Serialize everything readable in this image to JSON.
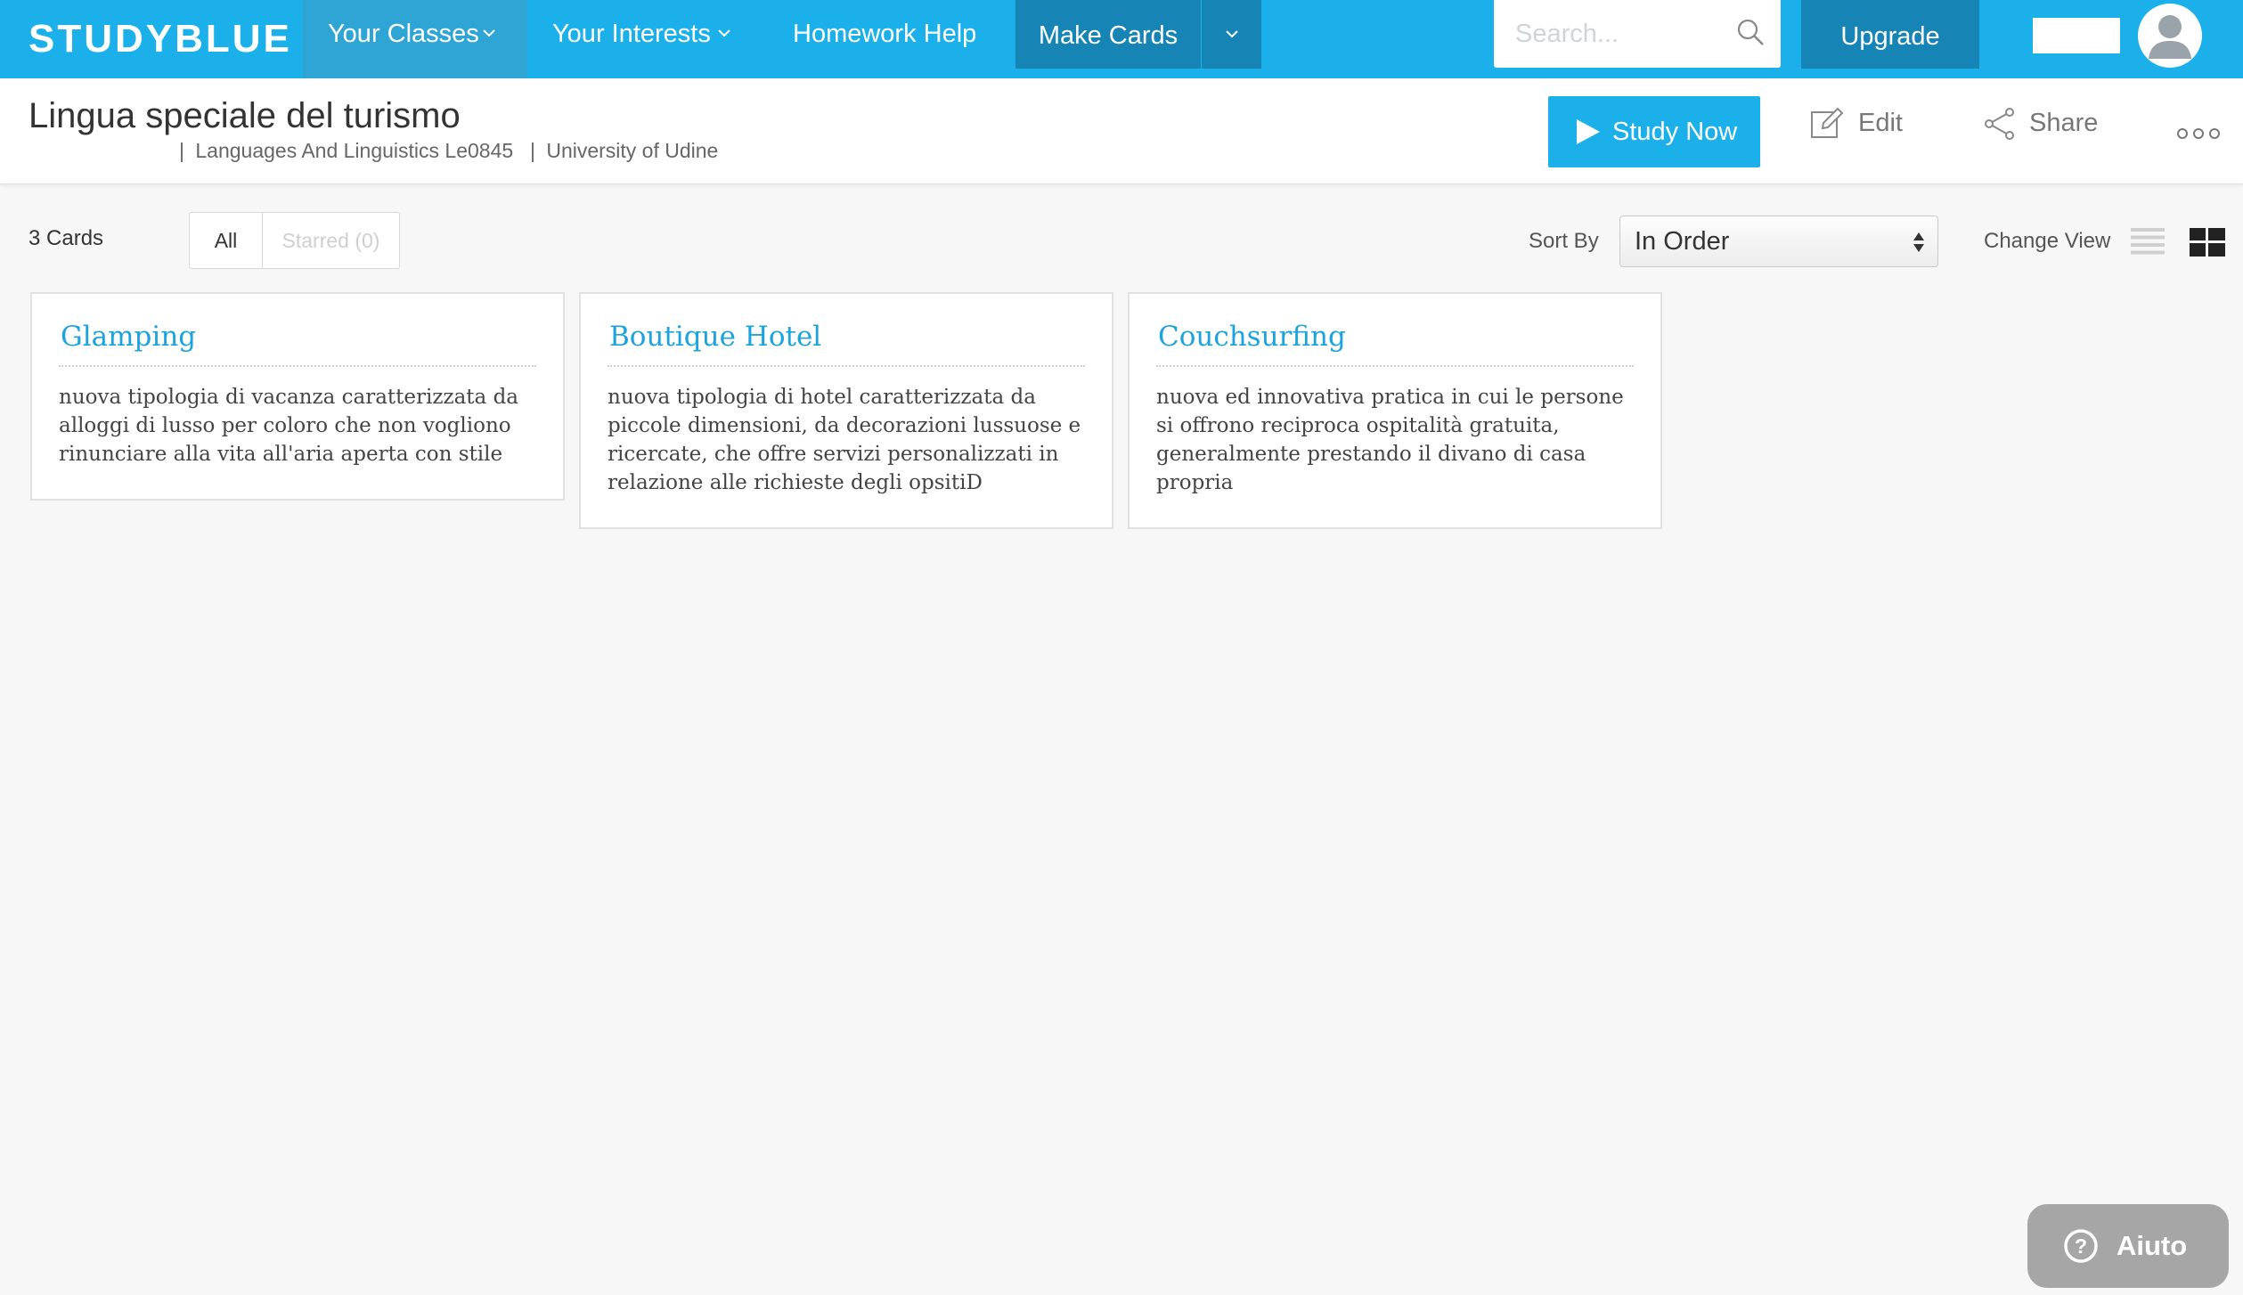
{
  "nav": {
    "logo": "STUDYBLUE",
    "your_classes": "Your Classes",
    "your_interests": "Your Interests",
    "homework_help": "Homework Help",
    "make_cards": "Make Cards",
    "search_placeholder": "Search...",
    "upgrade": "Upgrade"
  },
  "header": {
    "title": "Lingua speciale del turismo",
    "subject": "Languages And Linguistics Le0845",
    "school": "University of Udine",
    "study_now": "Study Now",
    "edit": "Edit",
    "share": "Share"
  },
  "toolbar": {
    "card_count": "3 Cards",
    "filter_all": "All",
    "filter_starred": "Starred (0)",
    "sort_label": "Sort By",
    "sort_value": "In Order",
    "change_view_label": "Change View"
  },
  "cards": [
    {
      "term": "Glamping",
      "definition": "nuova tipologia di vacanza caratterizzata da alloggi di lusso per coloro che non vogliono rinunciare alla vita all'aria aperta con stile"
    },
    {
      "term": "Boutique Hotel",
      "definition": "nuova tipologia di hotel caratterizzata da piccole dimensioni, da decorazioni lussuose e ricercate, che offre servizi personalizzati in relazione alle richieste degli opsitiD"
    },
    {
      "term": "Couchsurfing",
      "definition": "nuova ed innovativa pratica in cui le persone si offrono reciproca ospitalità gratuita, generalmente prestando il divano di casa propria"
    }
  ],
  "help": {
    "label": "Aiuto"
  },
  "colors": {
    "brand_blue": "#1cb0ea",
    "dark_blue": "#1684b4",
    "card_title_blue": "#1ca3dd"
  }
}
